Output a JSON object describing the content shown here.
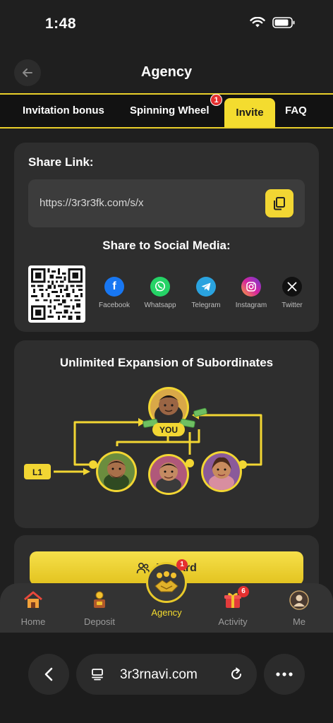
{
  "status": {
    "time": "1:48"
  },
  "header": {
    "title": "Agency"
  },
  "tabs": [
    {
      "label": "Invitation bonus"
    },
    {
      "label": "Spinning Wheel",
      "badge": "1"
    },
    {
      "label": "Invite",
      "active": true
    },
    {
      "label": "FAQ"
    }
  ],
  "share": {
    "label": "Share Link:",
    "link": "https://3r3r3fk.com/s/x",
    "social_title": "Share to Social Media:",
    "socials": [
      {
        "label": "Facebook",
        "icon": "facebook-icon",
        "color": "#1877f2"
      },
      {
        "label": "Whatsapp",
        "icon": "whatsapp-icon",
        "color": "#25d366"
      },
      {
        "label": "Telegram",
        "icon": "telegram-icon",
        "color": "#2aa3df"
      },
      {
        "label": "Instagram",
        "icon": "instagram-icon",
        "color": "#d6249f"
      },
      {
        "label": "Twitter",
        "icon": "x-icon",
        "color": "#111111"
      }
    ]
  },
  "expansion": {
    "title": "Unlimited Expansion of Subordinates",
    "you_label": "YOU",
    "level_label": "L1"
  },
  "reward_button": {
    "label": "Reward"
  },
  "bottom_nav": {
    "home": "Home",
    "deposit": "Deposit",
    "agency": "Agency",
    "agency_badge": "1",
    "activity": "Activity",
    "activity_badge": "6",
    "me": "Me"
  },
  "browser": {
    "url": "3r3rnavi.com"
  },
  "colors": {
    "accent": "#f4dc2f",
    "card": "#2e2e2e",
    "background": "#1f1f1f"
  }
}
